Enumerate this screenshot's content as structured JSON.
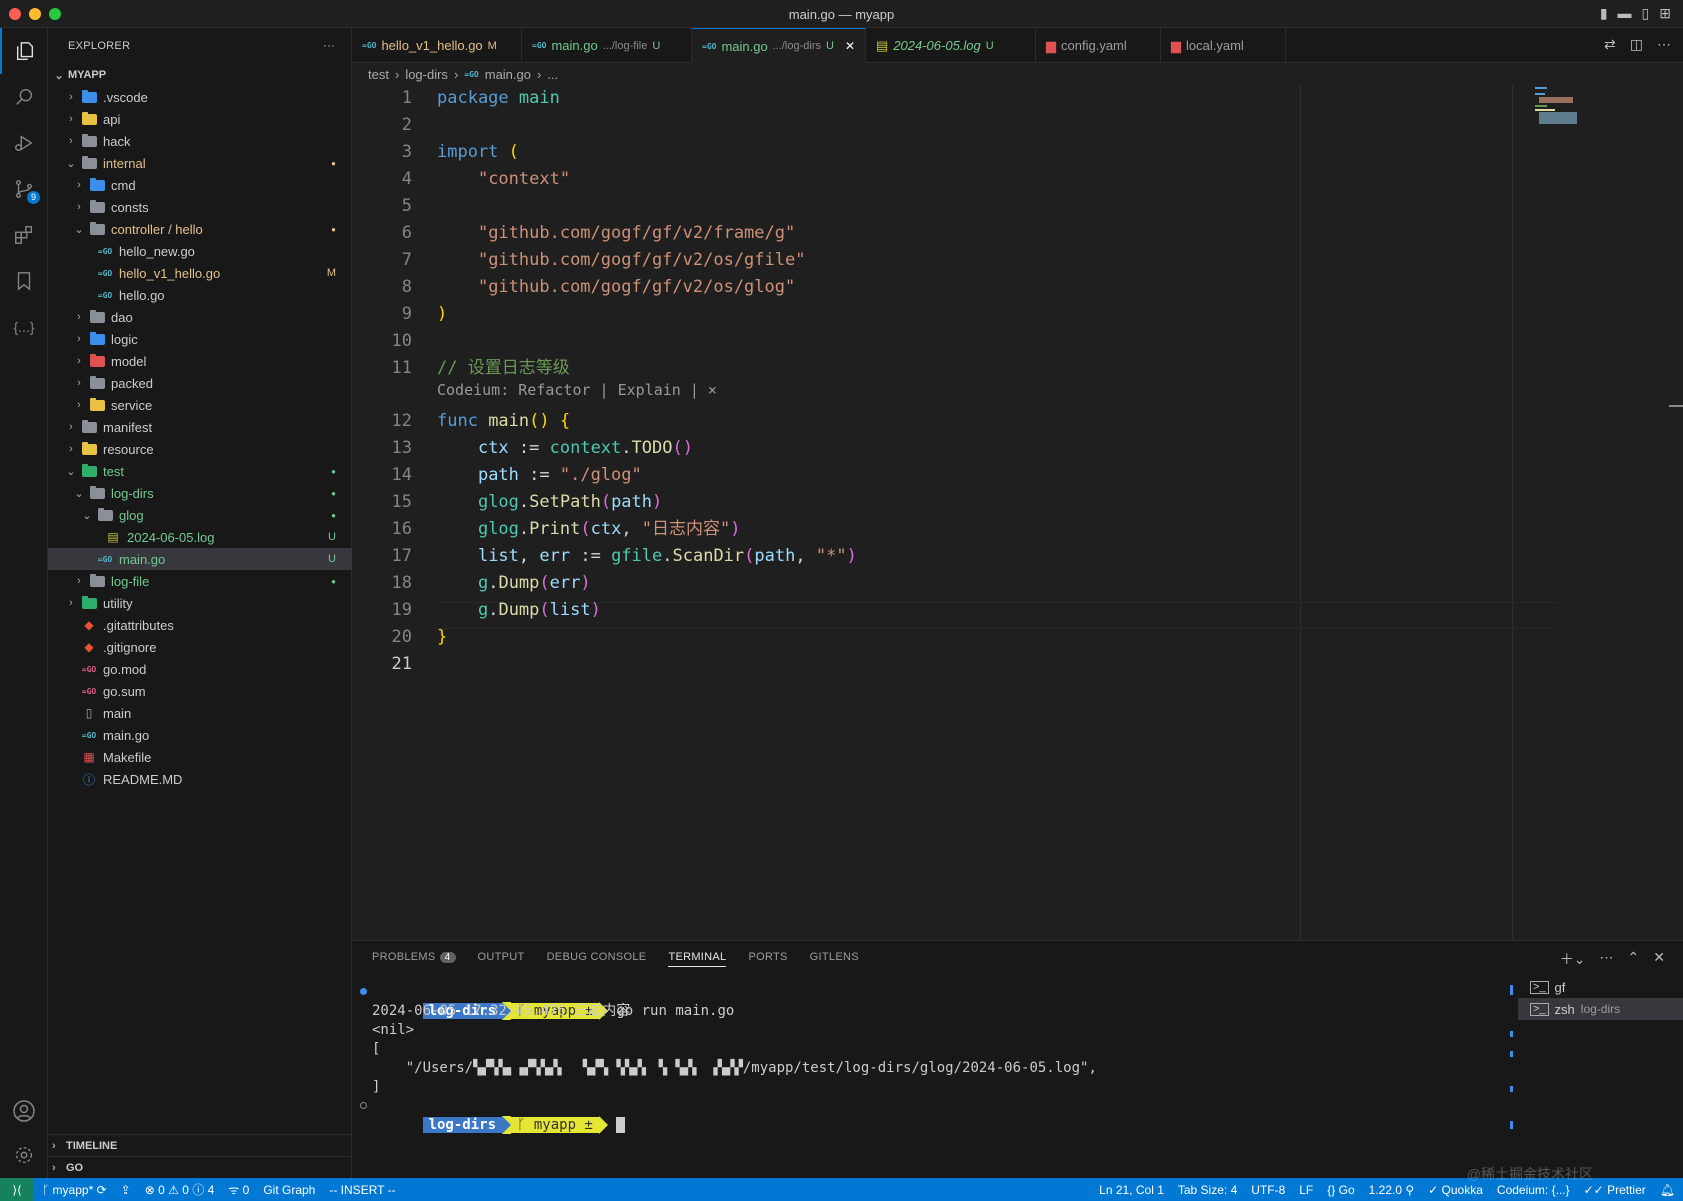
{
  "window": {
    "title": "main.go — myapp"
  },
  "colors": {
    "accent": "#0078d4",
    "statusbar": "#0078d4",
    "remote": "#16825d",
    "modified": "#e2c08d",
    "untracked": "#73c991"
  },
  "activity": {
    "source_control_badge": "9"
  },
  "explorer": {
    "header": "EXPLORER",
    "more": "···",
    "root": "MYAPP",
    "items": [
      {
        "label": ".vscode",
        "icon": "vscode-folder-icon",
        "depth": 1,
        "state": "closed"
      },
      {
        "label": "api",
        "icon": "api-folder-icon",
        "depth": 1,
        "state": "closed"
      },
      {
        "label": "hack",
        "icon": "folder-icon",
        "depth": 1,
        "state": "closed"
      },
      {
        "label": "internal",
        "icon": "folder-open-icon",
        "depth": 1,
        "state": "open",
        "status": "●"
      },
      {
        "label": "cmd",
        "icon": "cmd-folder-icon",
        "depth": 2,
        "state": "closed"
      },
      {
        "label": "consts",
        "icon": "folder-icon",
        "depth": 2,
        "state": "closed"
      },
      {
        "label": "controller / hello",
        "icon": "folder-open-icon",
        "depth": 2,
        "state": "open",
        "status": "●"
      },
      {
        "label": "hello_new.go",
        "icon": "go-file-icon",
        "depth": 3,
        "state": "file"
      },
      {
        "label": "hello_v1_hello.go",
        "icon": "go-file-icon",
        "depth": 3,
        "state": "file",
        "status": "M"
      },
      {
        "label": "hello.go",
        "icon": "go-file-icon",
        "depth": 3,
        "state": "file"
      },
      {
        "label": "dao",
        "icon": "folder-icon",
        "depth": 2,
        "state": "closed"
      },
      {
        "label": "logic",
        "icon": "logic-folder-icon",
        "depth": 2,
        "state": "closed"
      },
      {
        "label": "model",
        "icon": "model-folder-icon",
        "depth": 2,
        "state": "closed"
      },
      {
        "label": "packed",
        "icon": "folder-icon",
        "depth": 2,
        "state": "closed"
      },
      {
        "label": "service",
        "icon": "service-folder-icon",
        "depth": 2,
        "state": "closed"
      },
      {
        "label": "manifest",
        "icon": "folder-icon",
        "depth": 1,
        "state": "closed"
      },
      {
        "label": "resource",
        "icon": "resource-folder-icon",
        "depth": 1,
        "state": "closed"
      },
      {
        "label": "test",
        "icon": "test-folder-icon",
        "depth": 1,
        "state": "open",
        "status": "●"
      },
      {
        "label": "log-dirs",
        "icon": "folder-open-icon",
        "depth": 2,
        "state": "open",
        "status": "●"
      },
      {
        "label": "glog",
        "icon": "folder-open-icon",
        "depth": 3,
        "state": "open",
        "status": "●"
      },
      {
        "label": "2024-06-05.log",
        "icon": "log-file-icon",
        "depth": 4,
        "state": "file",
        "status": "U"
      },
      {
        "label": "main.go",
        "icon": "go-file-icon",
        "depth": 3,
        "state": "file",
        "status": "U",
        "selected": true
      },
      {
        "label": "log-file",
        "icon": "folder-icon",
        "depth": 2,
        "state": "closed",
        "status": "●"
      },
      {
        "label": "utility",
        "icon": "utility-folder-icon",
        "depth": 1,
        "state": "closed"
      },
      {
        "label": ".gitattributes",
        "icon": "git-icon",
        "depth": 1,
        "state": "file"
      },
      {
        "label": ".gitignore",
        "icon": "git-icon",
        "depth": 1,
        "state": "file"
      },
      {
        "label": "go.mod",
        "icon": "go-mod-icon",
        "depth": 1,
        "state": "file"
      },
      {
        "label": "go.sum",
        "icon": "go-mod-icon",
        "depth": 1,
        "state": "file"
      },
      {
        "label": "main",
        "icon": "file-icon",
        "depth": 1,
        "state": "file"
      },
      {
        "label": "main.go",
        "icon": "go-file-icon",
        "depth": 1,
        "state": "file"
      },
      {
        "label": "Makefile",
        "icon": "makefile-icon",
        "depth": 1,
        "state": "file"
      },
      {
        "label": "README.MD",
        "icon": "info-icon",
        "depth": 1,
        "state": "file"
      }
    ],
    "sections": {
      "timeline": "TIMELINE",
      "go": "GO"
    }
  },
  "tabs": [
    {
      "label": "hello_v1_hello.go",
      "desc": "",
      "flag": "M",
      "icon": "go-file-icon"
    },
    {
      "label": "main.go",
      "desc": ".../log-file",
      "flag": "U",
      "icon": "go-file-icon"
    },
    {
      "label": "main.go",
      "desc": ".../log-dirs",
      "flag": "U",
      "icon": "go-file-icon",
      "active": true
    },
    {
      "label": "2024-06-05.log",
      "desc": "",
      "flag": "U",
      "icon": "log-file-icon"
    },
    {
      "label": "config.yaml",
      "desc": "",
      "flag": "",
      "icon": "yaml-file-icon"
    },
    {
      "label": "local.yaml",
      "desc": "",
      "flag": "",
      "icon": "yaml-file-icon"
    }
  ],
  "breadcrumb": {
    "parts": [
      "test",
      "log-dirs",
      "main.go",
      "..."
    ]
  },
  "editor": {
    "codelens": "Codeium: Refactor | Explain | ×",
    "current_line": 21,
    "lines": [
      {
        "n": "1",
        "tokens": [
          [
            "kw",
            "package "
          ],
          [
            "pkg",
            "main"
          ]
        ]
      },
      {
        "n": "2",
        "tokens": []
      },
      {
        "n": "3",
        "tokens": [
          [
            "kw",
            "import "
          ],
          [
            "br1",
            "("
          ]
        ]
      },
      {
        "n": "4",
        "tokens": [
          [
            "pl",
            "    "
          ],
          [
            "str",
            "\"context\""
          ]
        ]
      },
      {
        "n": "5",
        "tokens": []
      },
      {
        "n": "6",
        "tokens": [
          [
            "pl",
            "    "
          ],
          [
            "str",
            "\"github.com/gogf/gf/v2/frame/g\""
          ]
        ]
      },
      {
        "n": "7",
        "tokens": [
          [
            "pl",
            "    "
          ],
          [
            "str",
            "\"github.com/gogf/gf/v2/os/gfile\""
          ]
        ]
      },
      {
        "n": "8",
        "tokens": [
          [
            "pl",
            "    "
          ],
          [
            "str",
            "\"github.com/gogf/gf/v2/os/glog\""
          ]
        ]
      },
      {
        "n": "9",
        "tokens": [
          [
            "br1",
            ")"
          ]
        ]
      },
      {
        "n": "10",
        "tokens": []
      },
      {
        "n": "11",
        "tokens": [
          [
            "cm",
            "// 设置日志等级"
          ]
        ]
      },
      {
        "n": "12",
        "tokens": [
          [
            "kw",
            "func "
          ],
          [
            "fn",
            "main"
          ],
          [
            "br1",
            "() {"
          ]
        ]
      },
      {
        "n": "13",
        "tokens": [
          [
            "pl",
            "    "
          ],
          [
            "var",
            "ctx"
          ],
          [
            "pl",
            " := "
          ],
          [
            "pkg",
            "context"
          ],
          [
            "pl",
            "."
          ],
          [
            "fn",
            "TODO"
          ],
          [
            "br2",
            "()"
          ]
        ]
      },
      {
        "n": "14",
        "tokens": [
          [
            "pl",
            "    "
          ],
          [
            "var",
            "path"
          ],
          [
            "pl",
            " := "
          ],
          [
            "str",
            "\"./glog\""
          ]
        ]
      },
      {
        "n": "15",
        "tokens": [
          [
            "pl",
            "    "
          ],
          [
            "pkg",
            "glog"
          ],
          [
            "pl",
            "."
          ],
          [
            "fn",
            "SetPath"
          ],
          [
            "br2",
            "("
          ],
          [
            "var",
            "path"
          ],
          [
            "br2",
            ")"
          ]
        ]
      },
      {
        "n": "16",
        "tokens": [
          [
            "pl",
            "    "
          ],
          [
            "pkg",
            "glog"
          ],
          [
            "pl",
            "."
          ],
          [
            "fn",
            "Print"
          ],
          [
            "br2",
            "("
          ],
          [
            "var",
            "ctx"
          ],
          [
            "pl",
            ", "
          ],
          [
            "str",
            "\"日志内容\""
          ],
          [
            "br2",
            ")"
          ]
        ]
      },
      {
        "n": "17",
        "tokens": [
          [
            "pl",
            "    "
          ],
          [
            "var",
            "list"
          ],
          [
            "pl",
            ", "
          ],
          [
            "var",
            "err"
          ],
          [
            "pl",
            " := "
          ],
          [
            "pkg",
            "gfile"
          ],
          [
            "pl",
            "."
          ],
          [
            "fn",
            "ScanDir"
          ],
          [
            "br2",
            "("
          ],
          [
            "var",
            "path"
          ],
          [
            "pl",
            ", "
          ],
          [
            "str",
            "\"*\""
          ],
          [
            "br2",
            ")"
          ]
        ]
      },
      {
        "n": "18",
        "tokens": [
          [
            "pl",
            "    "
          ],
          [
            "pkg",
            "g"
          ],
          [
            "pl",
            "."
          ],
          [
            "fn",
            "Dump"
          ],
          [
            "br2",
            "("
          ],
          [
            "var",
            "err"
          ],
          [
            "br2",
            ")"
          ]
        ]
      },
      {
        "n": "19",
        "tokens": [
          [
            "pl",
            "    "
          ],
          [
            "pkg",
            "g"
          ],
          [
            "pl",
            "."
          ],
          [
            "fn",
            "Dump"
          ],
          [
            "br2",
            "("
          ],
          [
            "var",
            "list"
          ],
          [
            "br2",
            ")"
          ]
        ]
      },
      {
        "n": "20",
        "tokens": [
          [
            "br1",
            "}"
          ]
        ]
      },
      {
        "n": "21",
        "tokens": []
      }
    ]
  },
  "panel": {
    "tabs": [
      {
        "label": "PROBLEMS",
        "badge": "4"
      },
      {
        "label": "OUTPUT"
      },
      {
        "label": "DEBUG CONSOLE"
      },
      {
        "label": "TERMINAL",
        "active": true
      },
      {
        "label": "PORTS"
      },
      {
        "label": "GITLENS"
      }
    ],
    "terminal": {
      "prompt_dir": "log-dirs",
      "prompt_branch": "myapp ±",
      "command": "go run main.go",
      "output": [
        "2024-06-05 17:32:45.476 日志内容",
        "<nil>",
        "[",
        "    \"/Users/▚▞▚▚▖▗▞▚▚▞▖  ▚▞▚ ▚▚▞▖ ▚ ▚▞▖ ▗▚▞▞/myapp/test/log-dirs/glog/2024-06-05.log\",",
        "]"
      ]
    },
    "terminal_list": [
      {
        "label": "gf",
        "desc": ""
      },
      {
        "label": "zsh",
        "desc": "log-dirs",
        "active": true
      }
    ]
  },
  "status": {
    "branch": "myapp*",
    "errors": "0",
    "warnings": "0",
    "infos": "4",
    "ports": "0",
    "git_graph": "Git Graph",
    "mode": "-- INSERT --",
    "position": "Ln 21, Col 1",
    "tab_size": "Tab Size: 4",
    "encoding": "UTF-8",
    "eol": "LF",
    "language": "Go",
    "go_version": "1.22.0",
    "quokka": "Quokka",
    "codeium": "Codeium: {...}",
    "prettier": "Prettier"
  },
  "watermark": "@稀土掘金技术社区"
}
